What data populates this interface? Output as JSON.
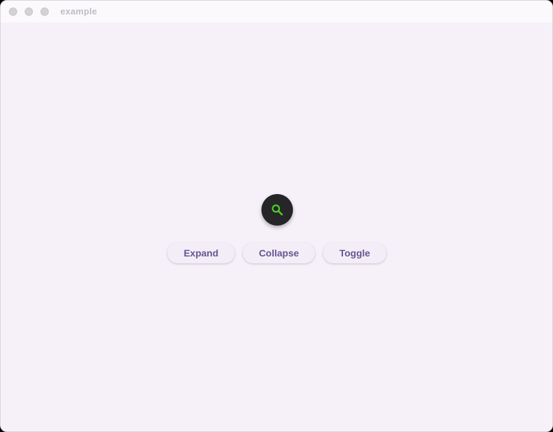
{
  "window": {
    "title": "example"
  },
  "fab": {
    "icon": "search-icon",
    "icon_color": "#4cd12a",
    "background": "#262528"
  },
  "buttons": {
    "expand_label": "Expand",
    "collapse_label": "Collapse",
    "toggle_label": "Toggle"
  },
  "colors": {
    "surface": "#f6f1f8",
    "button_text": "#65558f"
  }
}
